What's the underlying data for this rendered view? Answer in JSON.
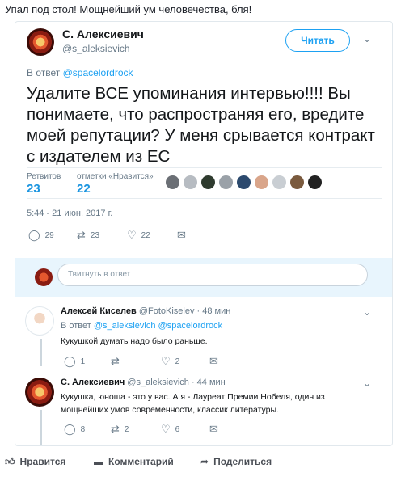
{
  "post": {
    "caption": "Упал под стол! Мощнейший ум человечества, бля!"
  },
  "tweet": {
    "author_name": "С. Алексиевич",
    "author_handle": "@s_aleksievich",
    "follow_label": "Читать",
    "reply_to_prefix": "В ответ",
    "reply_to_handle": "@spacelordrock",
    "text": "Удалите ВСЕ упоминания интервью!!!! Вы понимаете, что распространяя его, вредите моей репутации? У меня срывается контракт с издателем из ЕС",
    "retweets_label": "Ретвитов",
    "retweets_count": "23",
    "likes_label": "отметки «Нравится»",
    "likes_count": "22",
    "timestamp": "5:44 - 21 июн. 2017 г.",
    "actions": {
      "replies": "29",
      "retweets": "23",
      "likes": "22"
    }
  },
  "reply_box": {
    "placeholder": "Твитнуть в ответ"
  },
  "replies": [
    {
      "name": "Алексей Киселев",
      "handle": "@FotoKiselev",
      "time": "· 48 мин",
      "reply_to_prefix": "В ответ",
      "reply_to_handles": "@s_aleksievich @spacelordrock",
      "text": "Кукушкой думать надо было раньше.",
      "actions": {
        "replies": "1",
        "retweets": "",
        "likes": "2"
      }
    },
    {
      "name": "С. Алексиевич",
      "handle": "@s_aleksievich",
      "time": "· 44 мин",
      "text": "Кукушка, юноша - это у вас. А я - Лауреат Премии Нобеля, один из мощнейших умов современности, классик литературы.",
      "actions": {
        "replies": "8",
        "retweets": "2",
        "likes": "6"
      }
    }
  ],
  "footer": {
    "like_label": "Нравится",
    "comment_label": "Комментарий",
    "share_label": "Поделиться"
  },
  "colors": {
    "accent": "#1da1f2",
    "muted": "#657786",
    "reply_box_bg": "#e8f5fd"
  },
  "icons": [
    "chevron-down-icon",
    "reply-icon",
    "retweet-icon",
    "heart-icon",
    "mail-icon",
    "thumbs-up-icon",
    "comment-icon",
    "share-icon"
  ]
}
